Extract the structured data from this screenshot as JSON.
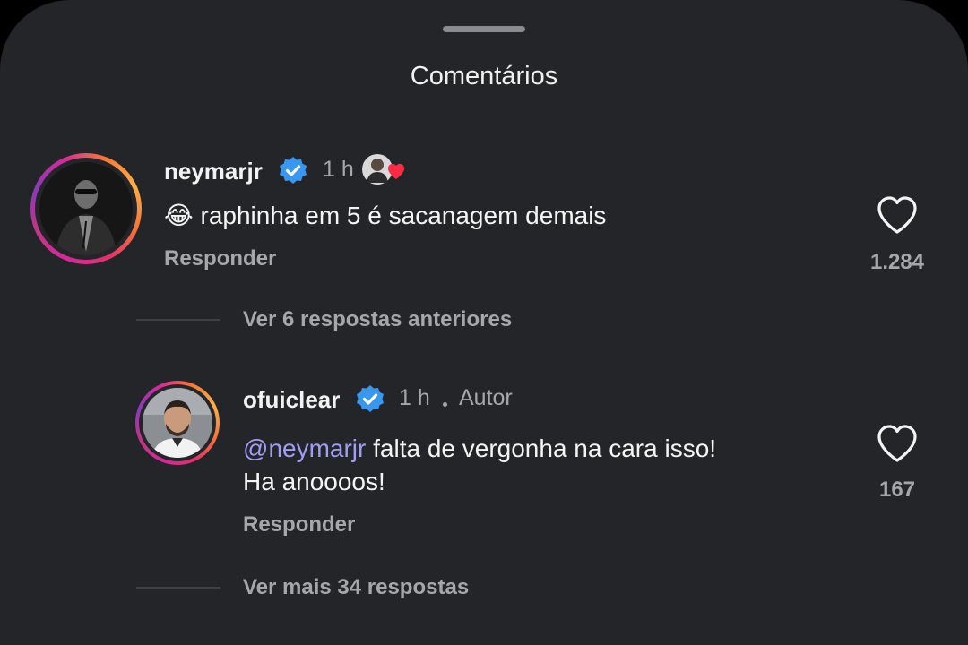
{
  "sheet": {
    "title": "Comentários"
  },
  "comments": [
    {
      "username": "neymarjr",
      "time": "1 h",
      "emoji": "😂",
      "text": "raphinha em 5 é sacanagem demais",
      "reply_label": "Responder",
      "like_count": "1.284"
    },
    {
      "username": "ofuiclear",
      "time": "1 h",
      "role": "Autor",
      "mention_symbol": "@",
      "mention_name": "neymarjr",
      "text_line1": " falta de vergonha na cara isso!",
      "text_line2": "Ha anoooos!",
      "reply_label": "Responder",
      "like_count": "167"
    }
  ],
  "view_previous_replies": "Ver 6 respostas anteriores",
  "view_more_replies": "Ver mais 34 respostas",
  "colors": {
    "background": "#242529",
    "verified_blue": "#3897f0",
    "mention": "#9f9df5",
    "secondary_text": "#a6a7ab"
  },
  "icons": [
    "verified-badge-icon",
    "heart-outline-icon",
    "author-liked-heart-icon"
  ]
}
